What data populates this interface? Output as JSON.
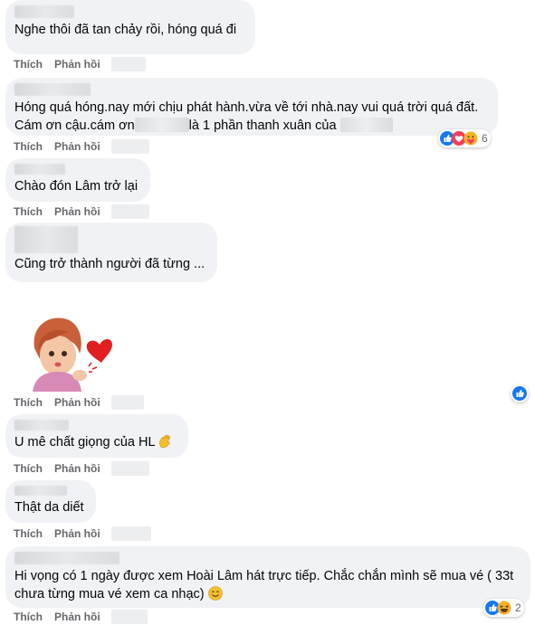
{
  "actions": {
    "like": "Thích",
    "reply": "Phản hồi"
  },
  "comments": [
    {
      "text": "Nghe thôi đã tan chảy rồi, hóng quá đi"
    },
    {
      "line1": "Hóng quá hóng.nay mới chịu phát hành.vừa về tới nhà.nay vui quá trời quá đất.",
      "line2a": "Cám ơn cậu.cám ơn",
      "line2b": "là 1 phần thanh xuân của",
      "reaction_count": "6"
    },
    {
      "text": "Chào đón Lâm trở lại"
    },
    {
      "text": "Cũng trở thành người đã từng ..."
    },
    {
      "sticker": "avatar-girl-heart-kiss-sticker",
      "reaction_count": ""
    },
    {
      "text": "U mê chất giọng của HL"
    },
    {
      "text": "Thật da diết"
    },
    {
      "line1": "Hi vọng có 1 ngày được xem Hoài Lâm hát trực tiếp. Chắc chắn mình sẽ mua vé ( 33t",
      "line2": "chưa từng mua vé xem ca nhạc)",
      "reaction_count": "2"
    }
  ],
  "colors": {
    "bubble": "#f0f2f5",
    "like_blue": "#1877f2",
    "love_red": "#f33e58",
    "meta_gray": "#65676b"
  }
}
